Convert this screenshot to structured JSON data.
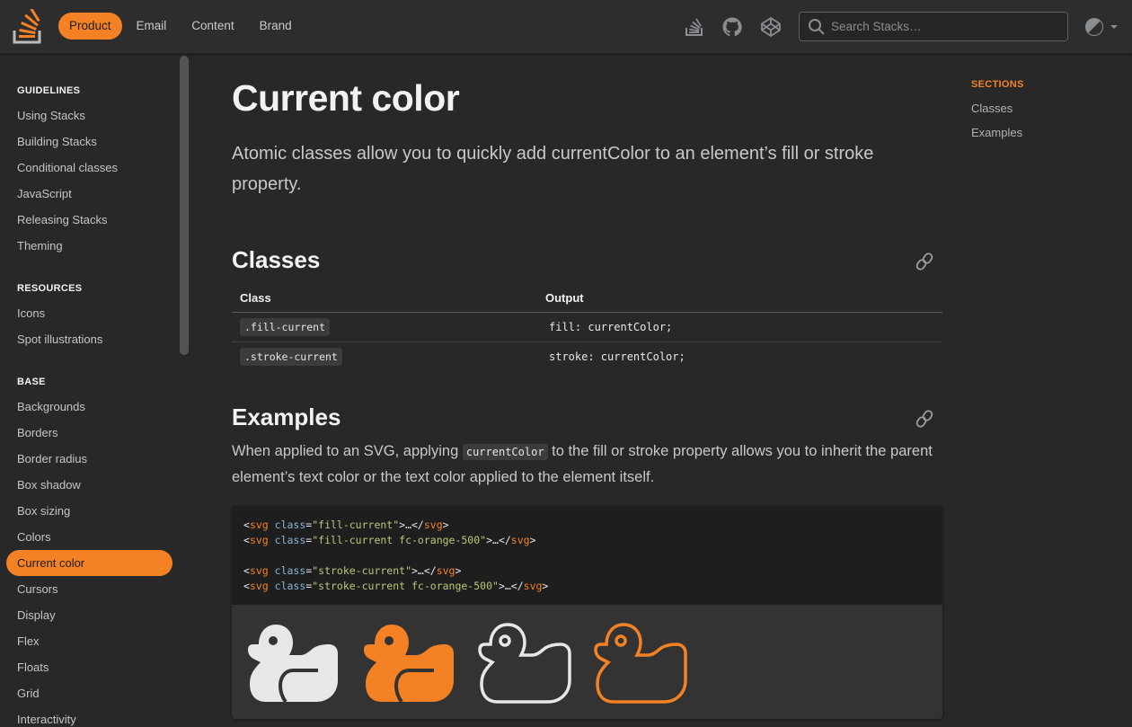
{
  "topbar": {
    "nav": [
      {
        "label": "Product",
        "active": true
      },
      {
        "label": "Email",
        "active": false
      },
      {
        "label": "Content",
        "active": false
      },
      {
        "label": "Brand",
        "active": false
      }
    ],
    "icons": [
      "stack-overflow-icon",
      "github-icon",
      "codepen-icon"
    ],
    "search": {
      "placeholder": "Search Stacks…",
      "value": ""
    },
    "theme_toggle_icon": "contrast-icon"
  },
  "sidebar": {
    "groups": [
      {
        "heading": "GUIDELINES",
        "items": [
          "Using Stacks",
          "Building Stacks",
          "Conditional classes",
          "JavaScript",
          "Releasing Stacks",
          "Theming"
        ]
      },
      {
        "heading": "RESOURCES",
        "items": [
          "Icons",
          "Spot illustrations"
        ]
      },
      {
        "heading": "BASE",
        "items": [
          "Backgrounds",
          "Borders",
          "Border radius",
          "Box shadow",
          "Box sizing",
          "Colors",
          "Current color",
          "Cursors",
          "Display",
          "Flex",
          "Floats",
          "Grid",
          "Interactivity"
        ]
      }
    ],
    "active_item": "Current color"
  },
  "page": {
    "title": "Current color",
    "lead": "Atomic classes allow you to quickly add currentColor to an element’s fill or stroke property.",
    "classes_heading": "Classes",
    "table": {
      "headers": [
        "Class",
        "Output"
      ],
      "rows": [
        {
          "class": ".fill-current",
          "output": "fill: currentColor;"
        },
        {
          "class": ".stroke-current",
          "output": "stroke: currentColor;"
        }
      ]
    },
    "examples_heading": "Examples",
    "examples_text_before": "When applied to an SVG, applying ",
    "examples_code": "currentColor",
    "examples_text_after": " to the fill or stroke property allows you to inherit the parent element’s text color or the text color applied to the element itself.",
    "code_lines": [
      {
        "class": "fill-current"
      },
      {
        "class": "fill-current fc-orange-500"
      },
      null,
      {
        "class": "stroke-current"
      },
      {
        "class": "stroke-current fc-orange-500"
      }
    ],
    "ducks": [
      {
        "style": "fill",
        "color": "#e6e7e9"
      },
      {
        "style": "fill",
        "color": "#f48225"
      },
      {
        "style": "stroke",
        "color": "#e6e7e9"
      },
      {
        "style": "stroke",
        "color": "#f48225"
      }
    ]
  },
  "toc": {
    "heading": "SECTIONS",
    "items": [
      "Classes",
      "Examples"
    ]
  },
  "colors": {
    "accent": "#f48225"
  }
}
